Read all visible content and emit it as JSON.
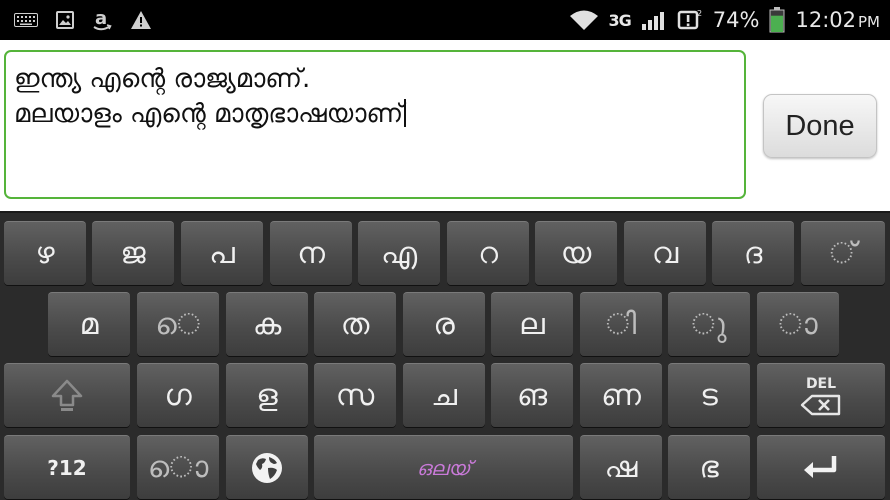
{
  "status_bar": {
    "left_icons": [
      "keyboard-icon",
      "image-icon",
      "amazon-icon",
      "warning-icon"
    ],
    "network_label": "3G",
    "right_icons": [
      "wifi-icon",
      "signal-icon",
      "notification-icon"
    ],
    "battery_percent": "74%",
    "battery_level": 0.74,
    "battery_color": "#4caf50",
    "time": "12:02",
    "ampm": "PM"
  },
  "editor": {
    "lines": [
      "ഇന്ത്യ എന്റെ രാജ്യമാണ്.",
      "മലയാളം എന്റെ മാതൃഭാഷയാണ്"
    ],
    "border_color": "#55b43a",
    "done_label": "Done"
  },
  "keyboard": {
    "row1": [
      "ഴ",
      "ജ",
      "പ",
      "ന",
      "എ",
      "റ",
      "യ",
      "വ",
      "ദ",
      "◌്"
    ],
    "row2": [
      "മ",
      "◌െ",
      "ക",
      "ത",
      "ര",
      "ല",
      "◌ി",
      "◌ു",
      "◌ാ"
    ],
    "row3": [
      "ഗ",
      "ള",
      "സ",
      "ച",
      "ങ",
      "ണ",
      "ട"
    ],
    "row3_shift_icon": "shift-arrow-icon",
    "row3_del_label": "DEL",
    "row4_symbols_label": "?12",
    "row4_vowel_sign": "◌ൊ",
    "row4_globe_icon": "globe-icon",
    "row4_logo_text": "ഒലയ്",
    "row4_keys": [
      "ഷ",
      "ഭ"
    ],
    "row4_enter_icon": "enter-icon"
  }
}
